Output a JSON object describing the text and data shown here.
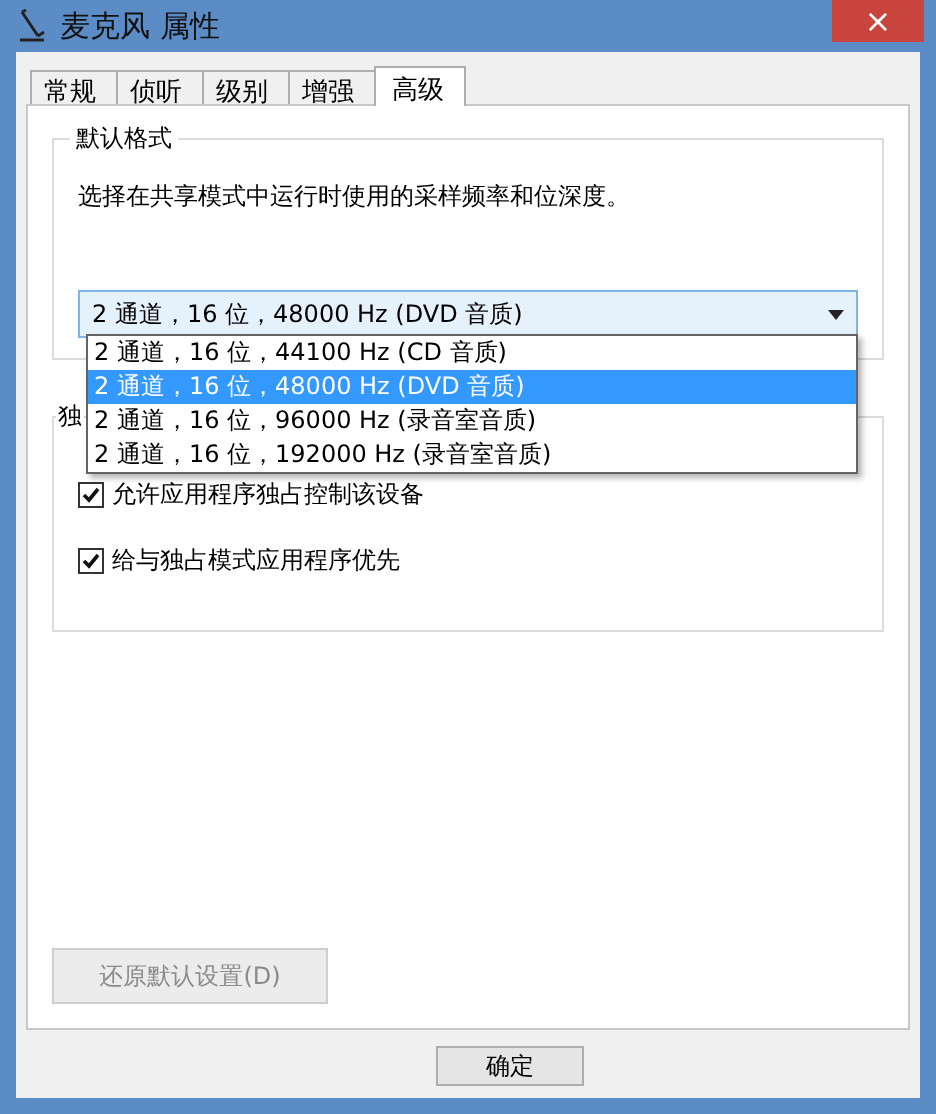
{
  "window": {
    "title": "麦克风 属性",
    "close": "×"
  },
  "tabs": [
    {
      "label": "常规",
      "selected": false
    },
    {
      "label": "侦听",
      "selected": false
    },
    {
      "label": "级别",
      "selected": false
    },
    {
      "label": "增强",
      "selected": false
    },
    {
      "label": "高级",
      "selected": true
    }
  ],
  "default_format": {
    "title": "默认格式",
    "description": "选择在共享模式中运行时使用的采样频率和位深度。",
    "value": "2 通道，16 位，48000 Hz (DVD 音质)",
    "options": [
      {
        "label": "2 通道，16 位，44100 Hz (CD 音质)",
        "selected": false
      },
      {
        "label": "2 通道，16 位，48000 Hz (DVD 音质)",
        "selected": true
      },
      {
        "label": "2 通道，16 位，96000 Hz (录音室音质)",
        "selected": false
      },
      {
        "label": "2 通道，16 位，192000 Hz (录音室音质)",
        "selected": false
      }
    ]
  },
  "exclusive_mode": {
    "title": "独",
    "options": [
      {
        "label": "允许应用程序独占控制该设备",
        "checked": true
      },
      {
        "label": "给与独占模式应用程序优先",
        "checked": true
      }
    ]
  },
  "restore_button": {
    "label": "还原默认设置(D)",
    "disabled": true
  },
  "buttons": [
    "确定"
  ]
}
